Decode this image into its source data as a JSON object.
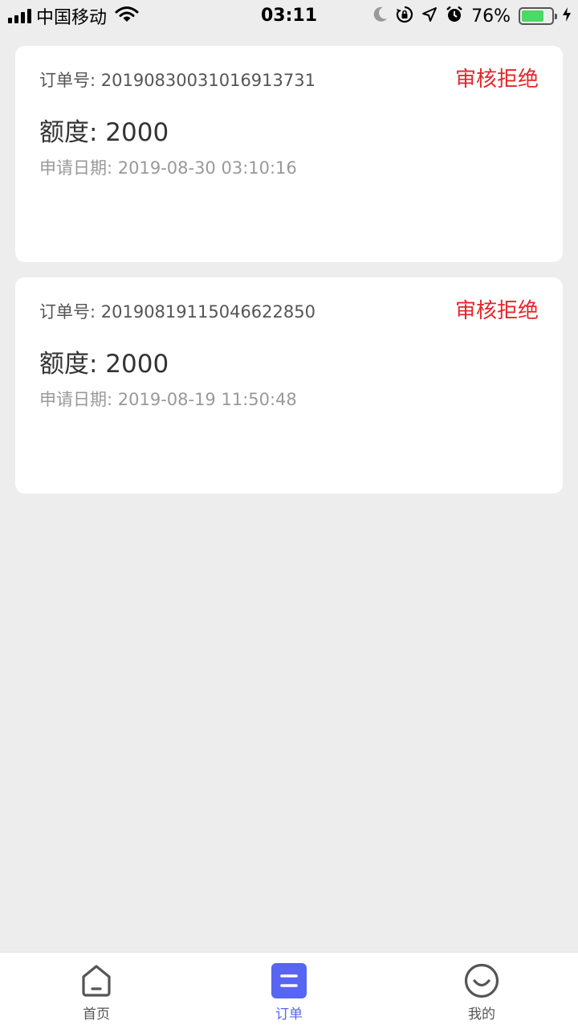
{
  "status_bar": {
    "carrier": "中国移动",
    "time": "03:11",
    "battery_percent": "76%",
    "battery_level": 0.76,
    "icons": [
      "signal-icon",
      "wifi-icon",
      "moon-icon",
      "rotation-lock-icon",
      "location-icon",
      "alarm-icon",
      "battery-icon",
      "charging-icon"
    ]
  },
  "orders": [
    {
      "order_no": "订单号: 20190830031016913731",
      "status": "审核拒绝",
      "amount": "额度: 2000",
      "date": "申请日期: 2019-08-30 03:10:16"
    },
    {
      "order_no": "订单号: 20190819115046622850",
      "status": "审核拒绝",
      "amount": "额度: 2000",
      "date": "申请日期: 2019-08-19 11:50:48"
    }
  ],
  "tabs": [
    {
      "label": "首页",
      "icon": "home-icon",
      "active": false
    },
    {
      "label": "订单",
      "icon": "order-list-icon",
      "active": true
    },
    {
      "label": "我的",
      "icon": "smile-icon",
      "active": false
    }
  ],
  "colors": {
    "background": "#ededed",
    "status_rejected": "#e3262a",
    "accent": "#5865f2",
    "battery": "#4cd964"
  }
}
